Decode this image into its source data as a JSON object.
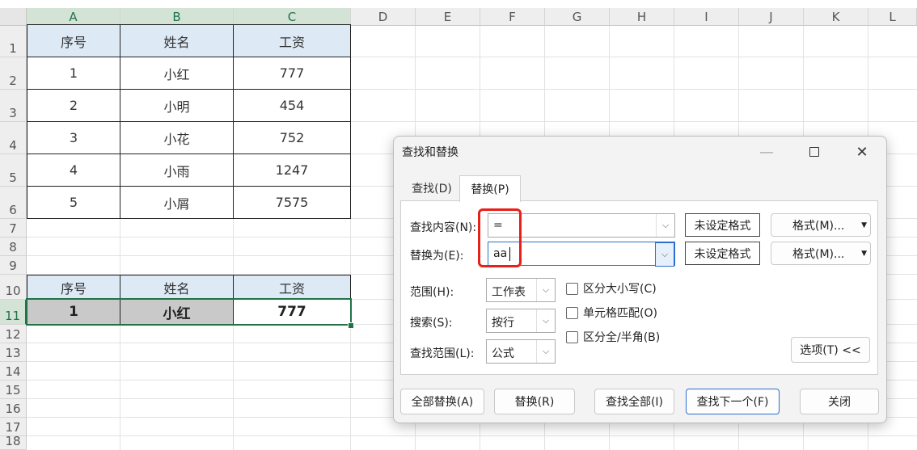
{
  "sheet": {
    "columns": [
      "A",
      "B",
      "C",
      "D",
      "E",
      "F",
      "G",
      "H",
      "I",
      "J",
      "K",
      "L"
    ],
    "rows": [
      "1",
      "2",
      "3",
      "4",
      "5",
      "6",
      "7",
      "8",
      "9",
      "10",
      "11",
      "12",
      "13",
      "14",
      "15",
      "16",
      "17",
      "18"
    ],
    "table1": {
      "headers": [
        "序号",
        "姓名",
        "工资"
      ],
      "rows": [
        [
          "1",
          "小红",
          "777"
        ],
        [
          "2",
          "小明",
          "454"
        ],
        [
          "3",
          "小花",
          "752"
        ],
        [
          "4",
          "小雨",
          "1247"
        ],
        [
          "5",
          "小屑",
          "7575"
        ]
      ]
    },
    "table2": {
      "headers": [
        "序号",
        "姓名",
        "工资"
      ],
      "row": [
        "1",
        "小红",
        "777"
      ]
    },
    "colors": {
      "accent": "#217346",
      "header_fill": "#dde9f5",
      "selected_fill": "#c9c9c9"
    }
  },
  "dialog": {
    "title": "查找和替换",
    "tabs": {
      "find": "查找(D)",
      "replace": "替换(P)"
    },
    "find_label": "查找内容(N):",
    "find_value": "=",
    "replace_label": "替换为(E):",
    "replace_value": "aa",
    "no_format_1": "未设定格式",
    "no_format_2": "未设定格式",
    "format_1": "格式(M)...",
    "format_2": "格式(M)...",
    "within_label": "范围(H):",
    "within_value": "工作表",
    "search_label": "搜索(S):",
    "search_value": "按行",
    "lookin_label": "查找范围(L):",
    "lookin_value": "公式",
    "match_case": "区分大小写(C)",
    "match_cell": "单元格匹配(O)",
    "match_width": "区分全/半角(B)",
    "options_button": "选项(T) <<",
    "replace_all": "全部替换(A)",
    "replace": "替换(R)",
    "find_all": "查找全部(I)",
    "find_next": "查找下一个(F)",
    "close": "关闭",
    "highlight_color": "#e8201a"
  }
}
